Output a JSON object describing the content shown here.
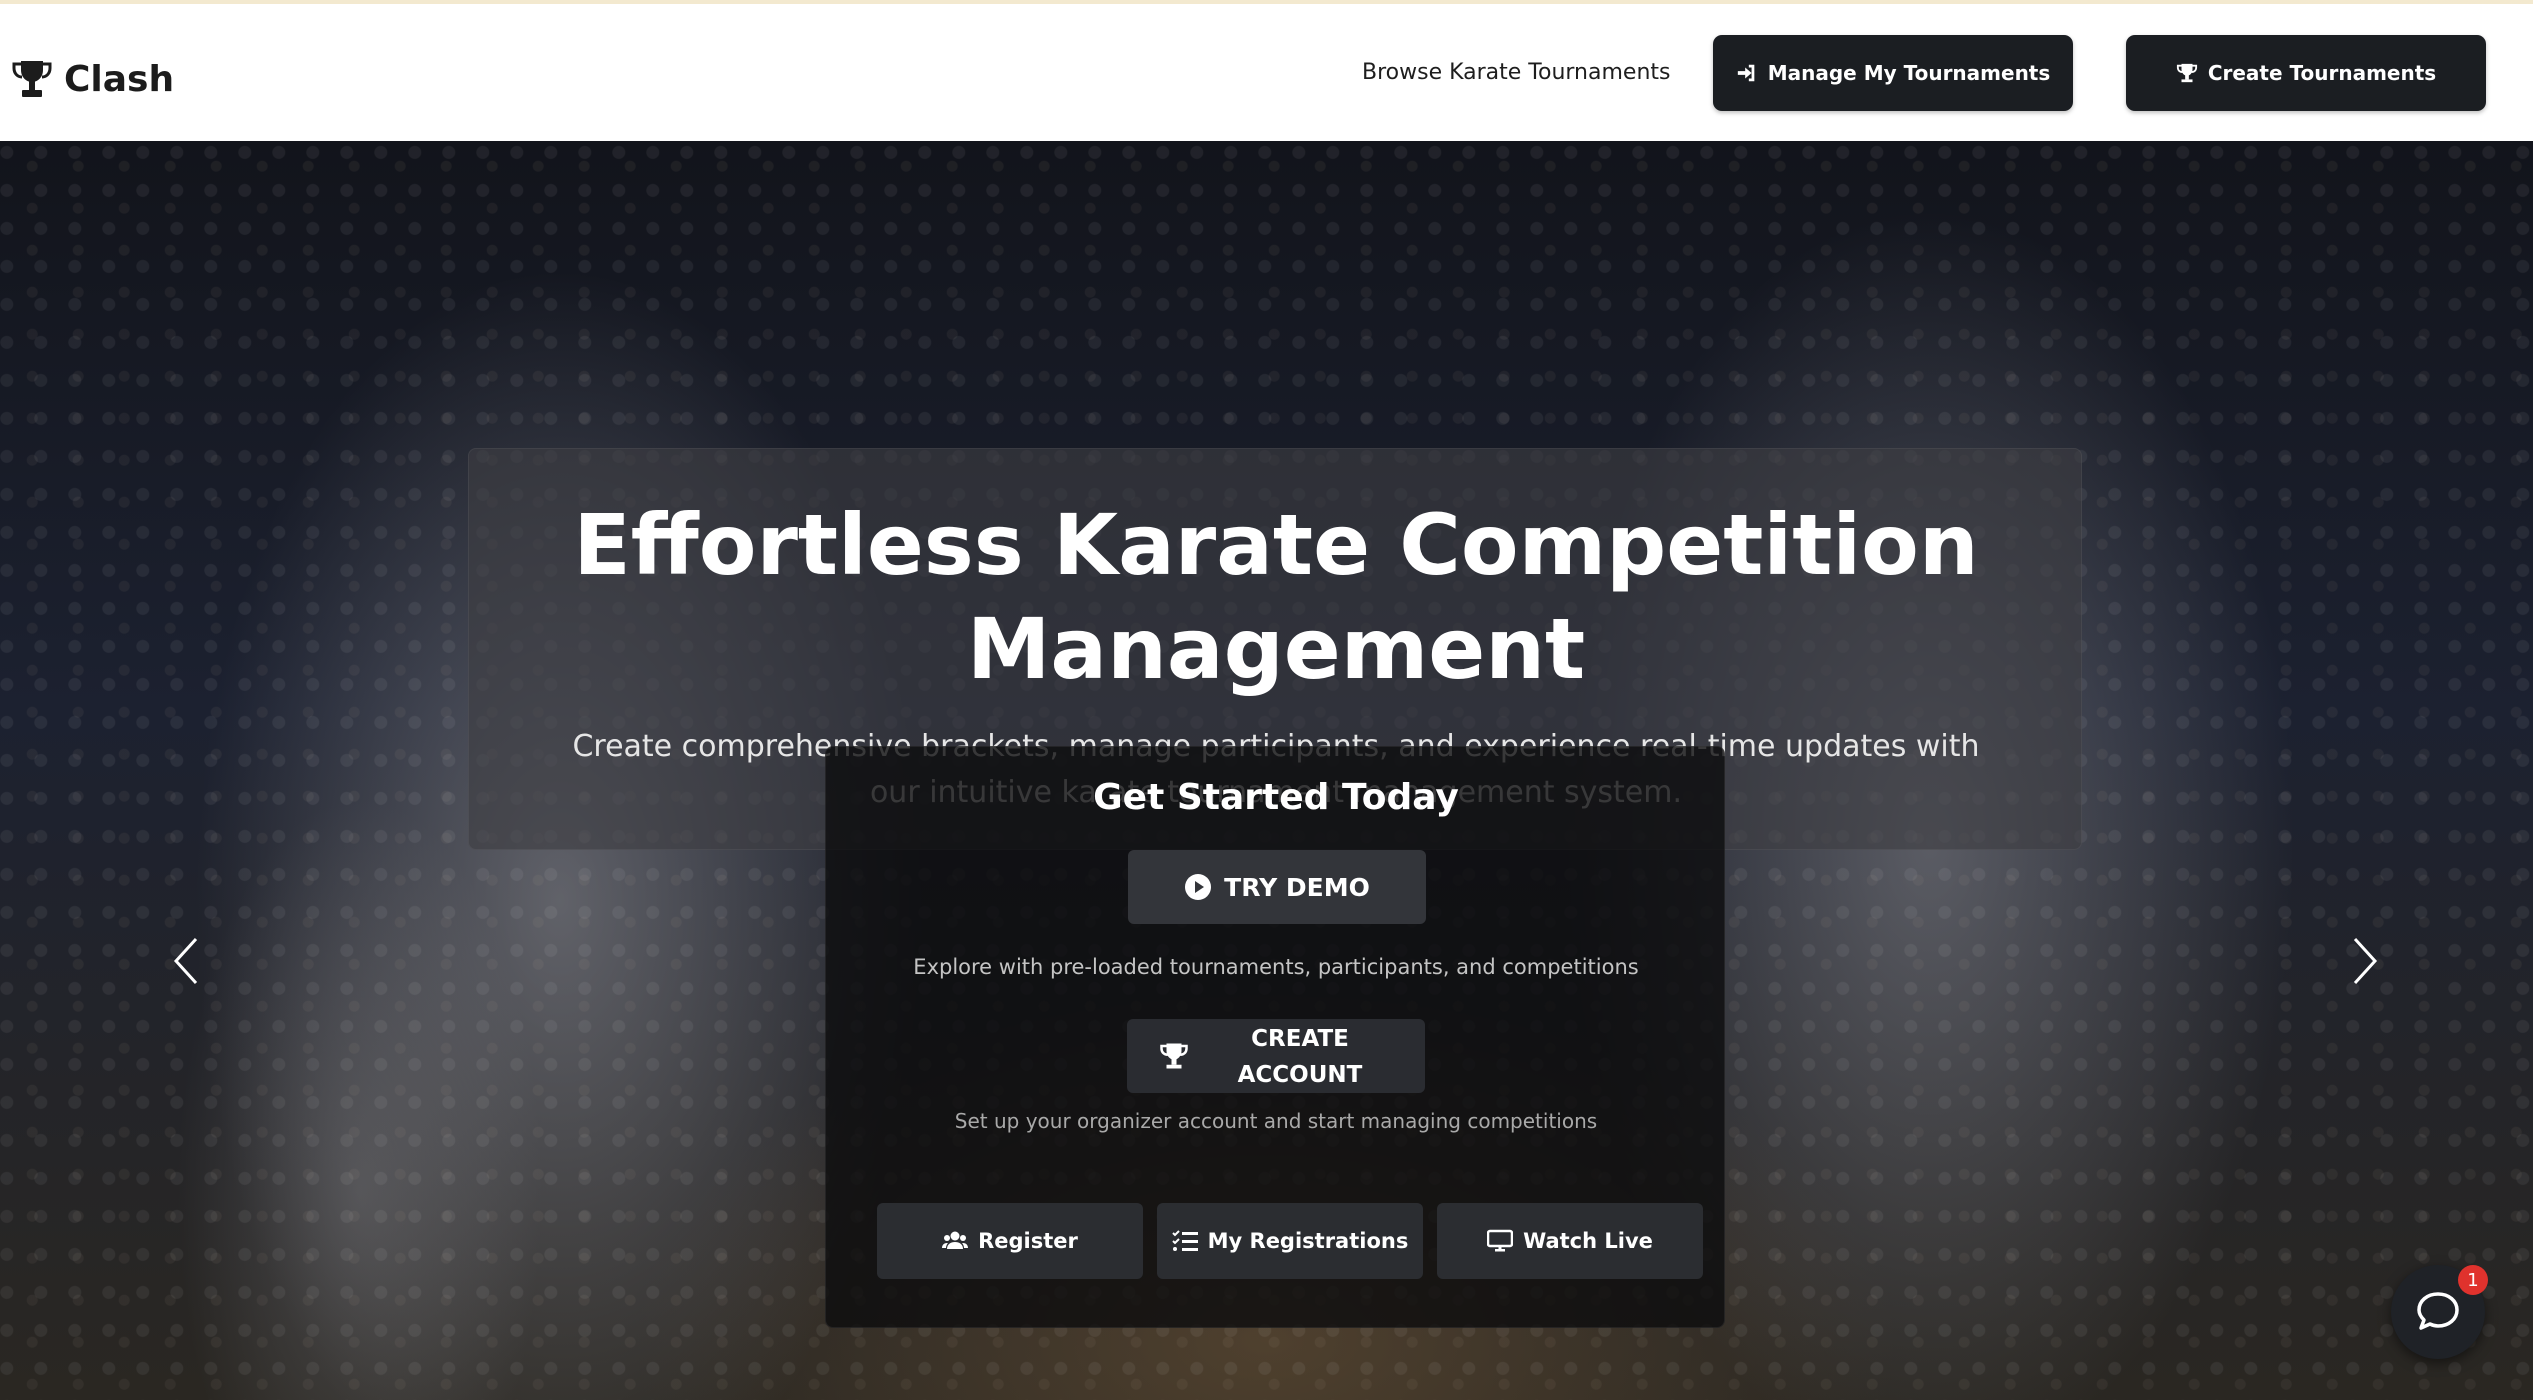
{
  "brand": {
    "name": "Clash",
    "icon": "trophy-icon"
  },
  "nav": {
    "browse_label": "Browse Karate Tournaments",
    "manage_label": "Manage My Tournaments",
    "create_label": "Create Tournaments"
  },
  "hero": {
    "title_line1": "Effortless Karate Competition",
    "title_line2": "Management",
    "subtitle": "Create comprehensive brackets, manage participants, and experience real-time updates with our intuitive karate tournament management system."
  },
  "get_started": {
    "title": "Get Started Today",
    "demo_label": "TRY DEMO",
    "demo_note": "Explore with pre-loaded tournaments, participants, and competitions",
    "account_label": "CREATE ACCOUNT",
    "account_note": "Set up your organizer account and start managing competitions"
  },
  "quick_actions": {
    "register_label": "Register",
    "my_registrations_label": "My Registrations",
    "watch_live_label": "Watch Live"
  },
  "chat": {
    "badge_count": "1"
  },
  "colors": {
    "dark_button": "#1b1e22",
    "badge": "#e0322d",
    "overlay": "#3e3e42"
  }
}
